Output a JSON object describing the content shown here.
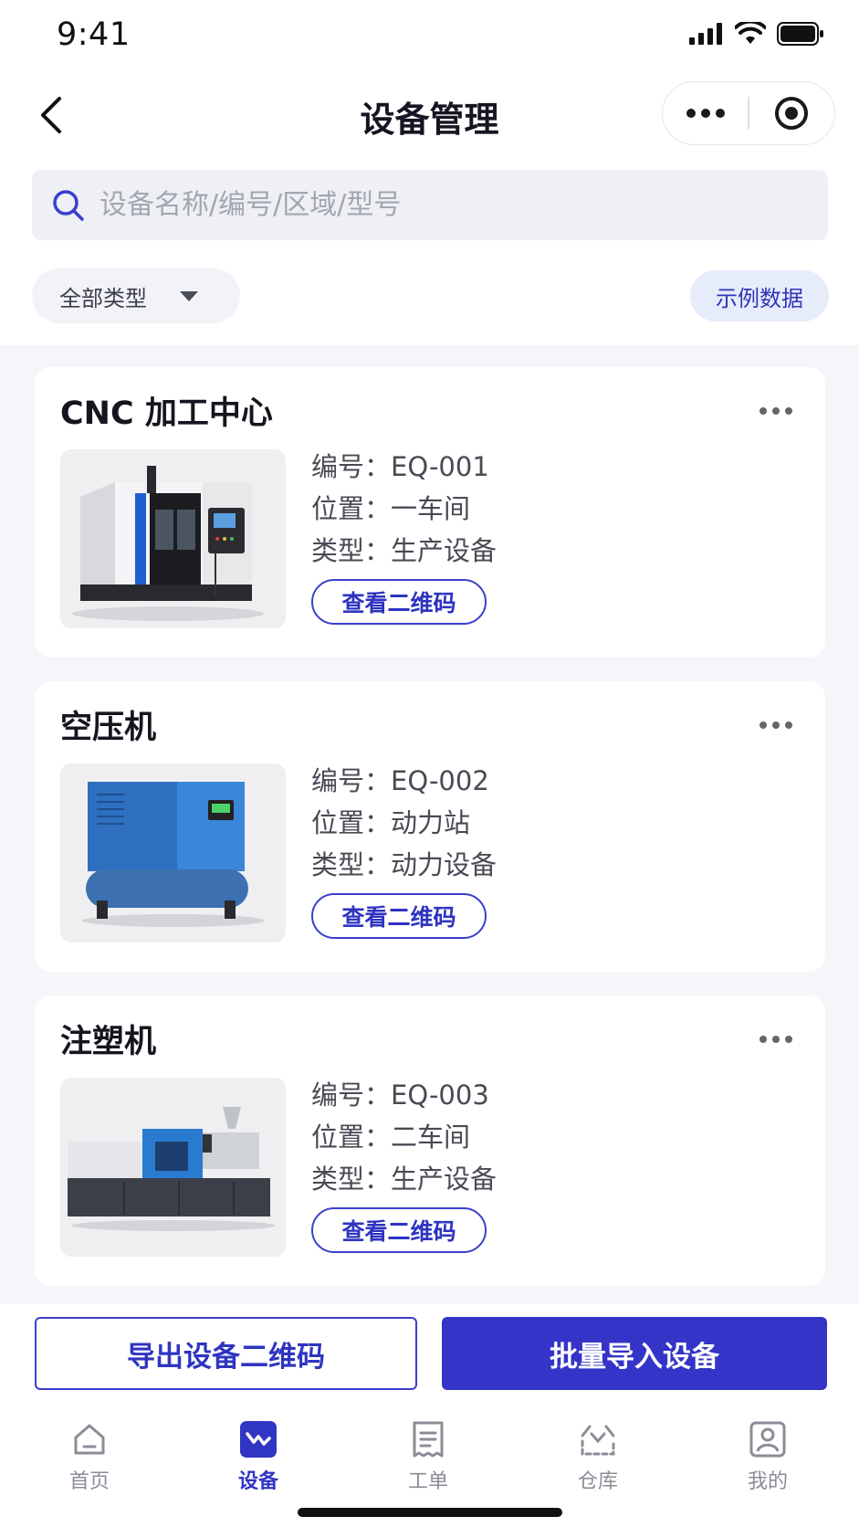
{
  "status_bar": {
    "time": "9:41"
  },
  "nav": {
    "title": "设备管理"
  },
  "search": {
    "placeholder": "设备名称/编号/区域/型号"
  },
  "filters": {
    "type_label": "全部类型",
    "sample_label": "示例数据"
  },
  "devices": [
    {
      "name": "CNC 加工中心",
      "code_label": "编号：",
      "code": "EQ-001",
      "location_label": "位置：",
      "location": "一车间",
      "type_label": "类型：",
      "type": "生产设备",
      "qr_label": "查看二维码"
    },
    {
      "name": "空压机",
      "code_label": "编号：",
      "code": "EQ-002",
      "location_label": "位置：",
      "location": "动力站",
      "type_label": "类型：",
      "type": "动力设备",
      "qr_label": "查看二维码"
    },
    {
      "name": "注塑机",
      "code_label": "编号：",
      "code": "EQ-003",
      "location_label": "位置：",
      "location": "二车间",
      "type_label": "类型：",
      "type": "生产设备",
      "qr_label": "查看二维码"
    }
  ],
  "actions": {
    "export_label": "导出设备二维码",
    "import_label": "批量导入设备"
  },
  "tabs": [
    {
      "label": "首页",
      "icon": "home-icon"
    },
    {
      "label": "设备",
      "icon": "equipment-icon",
      "active": true
    },
    {
      "label": "工单",
      "icon": "work-order-icon"
    },
    {
      "label": "仓库",
      "icon": "warehouse-icon"
    },
    {
      "label": "我的",
      "icon": "profile-icon"
    }
  ],
  "colors": {
    "primary": "#3434c8",
    "accent_light": "#e7ecfb",
    "background": "#f5f6fa"
  }
}
